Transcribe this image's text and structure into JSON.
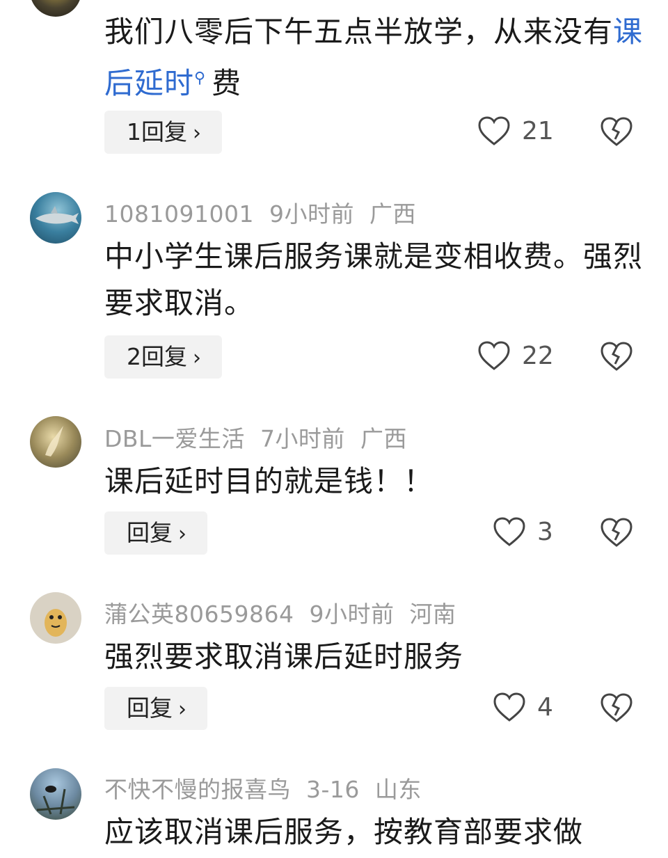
{
  "comments": [
    {
      "text_before": "我们八零后下午五点半放学，从来没有",
      "link_term": "课后延时",
      "text_after": "费",
      "reply_label": "1回复",
      "likes": "21"
    },
    {
      "username": "1081091001",
      "time": "9小时前",
      "region": "广西",
      "text": "中小学生课后服务课就是变相收费。强烈要求取消。",
      "reply_label": "2回复",
      "likes": "22"
    },
    {
      "username": "DBL一爱生活",
      "time": "7小时前",
      "region": "广西",
      "text": "课后延时目的就是钱！！",
      "reply_label": "回复",
      "likes": "3"
    },
    {
      "username": "蒲公英80659864",
      "time": "9小时前",
      "region": "河南",
      "text": "强烈要求取消课后延时服务",
      "reply_label": "回复",
      "likes": "4"
    },
    {
      "username": "不快不慢的报喜鸟",
      "time": "3-16",
      "region": "山东",
      "text": "应该取消课后服务，按教育部要求做"
    }
  ],
  "icons": {
    "chevron": "chevron-right-icon",
    "like": "heart-icon",
    "dislike": "broken-heart-icon",
    "search": "search-icon"
  },
  "colors": {
    "link": "#2f6bd0",
    "meta": "#9a9a9a",
    "reply_bg": "#f2f2f2"
  }
}
